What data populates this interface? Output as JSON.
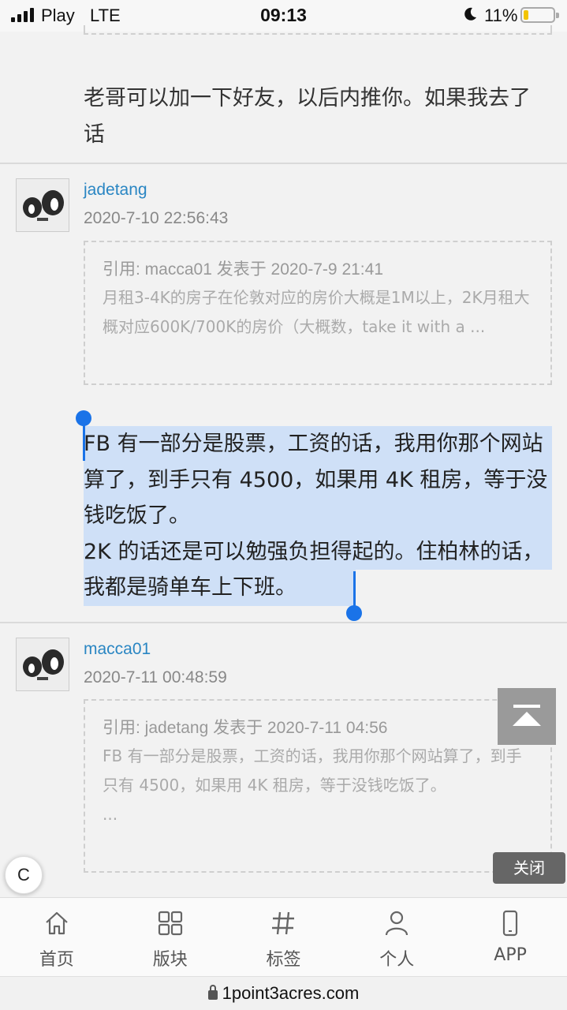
{
  "status_bar": {
    "carrier": "Play",
    "network": "LTE",
    "time": "09:13",
    "battery": "11%",
    "battery_fraction": 0.11
  },
  "posts": [
    {
      "text": "老哥可以加一下好友，以后内推你。如果我去了话"
    },
    {
      "username": "jadetang",
      "date": "2020-7-10 22:56:43",
      "quote_header": "引用: macca01 发表于 2020-7-9 21:41",
      "quote_body": "月租3-4K的房子在伦敦对应的房价大概是1M以上，2K月租大概对应600K/700K的房价（大概数，take it with a  ...",
      "text_line1": "FB 有一部分是股票，工资的话，我用你那个网站算了，到手只有 4500，如果用 4K 租房，等于没钱吃饭了。",
      "text_line2": "2K 的话还是可以勉强负担得起的。住柏林的话，我都是骑单车上下班。"
    },
    {
      "username": "macca01",
      "date": "2020-7-11 00:48:59",
      "quote_header": "引用: jadetang 发表于 2020-7-11 04:56",
      "quote_body": "FB 有一部分是股票，工资的话，我用你那个网站算了，到手只有 4500，如果用 4K 租房，等于没钱吃饭了。",
      "quote_more": "..."
    }
  ],
  "floating": {
    "close_label": "关闭",
    "c_label": "C",
    "back_to_top_icon": "arrow-up-to-top-icon"
  },
  "tabbar": {
    "items": [
      {
        "label": "首页",
        "icon": "home-icon"
      },
      {
        "label": "版块",
        "icon": "grid-icon"
      },
      {
        "label": "标签",
        "icon": "hashtag-icon"
      },
      {
        "label": "个人",
        "icon": "person-icon"
      },
      {
        "label": "APP",
        "icon": "phone-icon"
      }
    ]
  },
  "browser": {
    "url": "1point3acres.com"
  },
  "colors": {
    "link": "#2a86c3",
    "selection": "#cfe0f7",
    "selection_handle": "#1a73e8"
  }
}
